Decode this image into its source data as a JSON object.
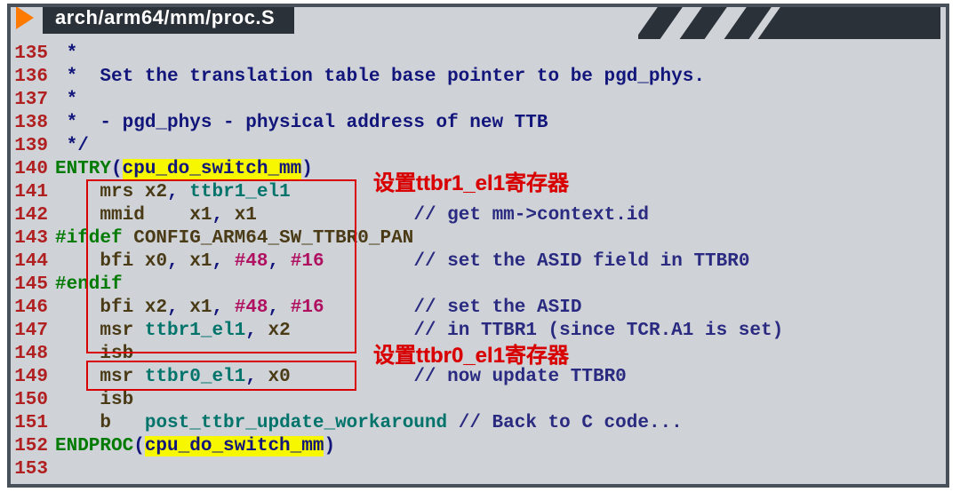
{
  "title": "arch/arm64/mm/proc.S",
  "annotations": {
    "a1": "设置ttbr1_el1寄存器",
    "a2": "设置ttbr0_el1寄存器"
  },
  "lines": {
    "135": {
      "ln": "135",
      "c0": " *"
    },
    "136": {
      "ln": "136",
      "c0": " *  Set the translation table base pointer to be pgd_phys."
    },
    "137": {
      "ln": "137",
      "c0": " *"
    },
    "138": {
      "ln": "138",
      "c0": " *  - pgd_phys - physical address of new TTB"
    },
    "139": {
      "ln": "139",
      "c0": " */"
    },
    "140": {
      "ln": "140",
      "kw": "ENTRY",
      "lp": "(",
      "fn": "cpu_do_switch_mm",
      "rp": ")"
    },
    "141": {
      "ln": "141",
      "ind": "    ",
      "inst": "mrs ",
      "r1": "x2",
      "sep": ", ",
      "r2": "ttbr1_el1"
    },
    "142": {
      "ln": "142",
      "ind": "    ",
      "inst": "mmid",
      "sp": "    ",
      "r1": "x1",
      "sep": ", ",
      "r2": "x1",
      "pad": "              ",
      "cmt": "// get mm->context.id"
    },
    "143": {
      "ln": "143",
      "kw": "#ifdef",
      "rest": " CONFIG_ARM64_SW_TTBR0_PAN"
    },
    "144": {
      "ln": "144",
      "ind": "    ",
      "inst": "bfi ",
      "r1": "x0",
      "c1": ", ",
      "r2": "x1",
      "c2": ", ",
      "n1": "#48",
      "c3": ", ",
      "n2": "#16",
      "pad": "        ",
      "cmt": "// set the ASID field in TTBR0"
    },
    "145": {
      "ln": "145",
      "kw": "#endif"
    },
    "146": {
      "ln": "146",
      "ind": "    ",
      "inst": "bfi ",
      "r1": "x2",
      "c1": ", ",
      "r2": "x1",
      "c2": ", ",
      "n1": "#48",
      "c3": ", ",
      "n2": "#16",
      "pad": "        ",
      "cmt": "// set the ASID"
    },
    "147": {
      "ln": "147",
      "ind": "    ",
      "inst": "msr ",
      "r1": "ttbr1_el1",
      "sep": ", ",
      "r2": "x2",
      "pad": "           ",
      "cmt": "// in TTBR1 (since TCR.A1 is set)"
    },
    "148": {
      "ln": "148",
      "ind": "    ",
      "inst": "isb"
    },
    "149": {
      "ln": "149",
      "ind": "    ",
      "inst": "msr ",
      "r1": "ttbr0_el1",
      "sep": ", ",
      "r2": "x0",
      "pad": "           ",
      "cmt": "// now update TTBR0"
    },
    "150": {
      "ln": "150",
      "ind": "    ",
      "inst": "isb"
    },
    "151": {
      "ln": "151",
      "ind": "    ",
      "inst": "b   ",
      "fn": "post_ttbr_update_workaround",
      "sp": " ",
      "cmt": "// Back to C code..."
    },
    "152": {
      "ln": "152",
      "kw": "ENDPROC",
      "lp": "(",
      "fn": "cpu_do_switch_mm",
      "rp": ")"
    },
    "153": {
      "ln": "153"
    }
  }
}
